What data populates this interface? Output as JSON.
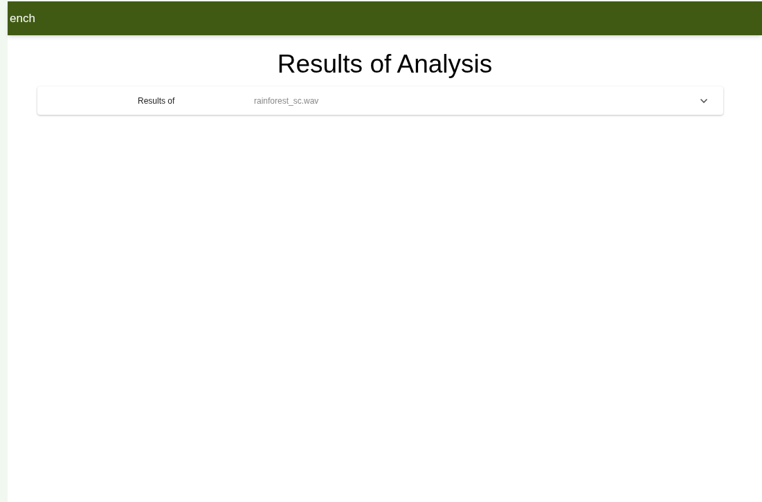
{
  "app_bar": {
    "title": "ench"
  },
  "heading": "Results of Analysis",
  "results_panel": {
    "label": "Results of",
    "file_name": "rainforest_sc.wav",
    "expanded": false
  }
}
